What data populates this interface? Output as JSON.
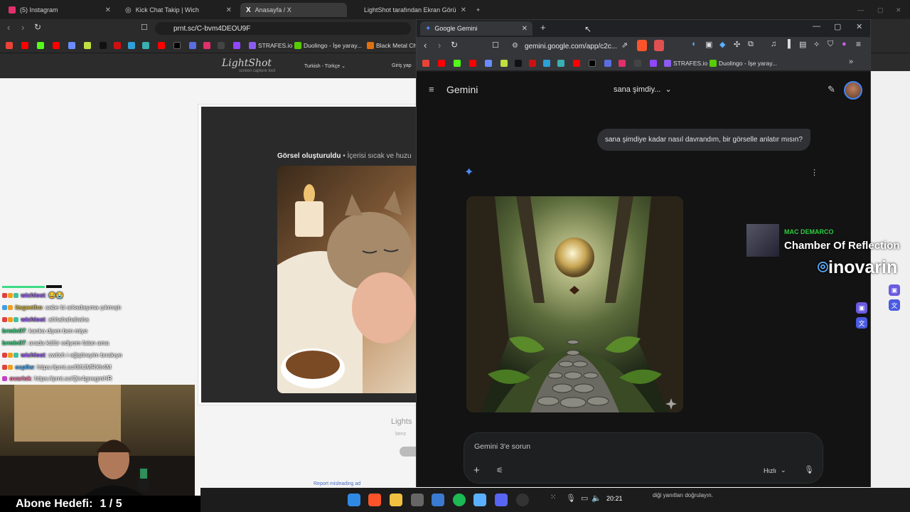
{
  "background_browser": {
    "tabs": [
      {
        "label": "(5) Instagram",
        "icon": "instagram-icon"
      },
      {
        "label": "Kick Chat Takip | Wich",
        "icon": "globe-icon"
      },
      {
        "label": "Anasayfa / X",
        "icon": "x-icon"
      },
      {
        "label": "LightShot tarafından Ekran Görü",
        "icon": "lightshot-icon"
      }
    ],
    "url": "prnt.sc/C-bvm4DEOU9F",
    "bookmarks": [
      "STRAFES.io",
      "Duolingo - İşe yaray...",
      "Black Metal Chr"
    ]
  },
  "lightshot": {
    "logo": "LightShot",
    "logo_sub": "screen capture tool",
    "language": "Turkish - Türkçe",
    "login": "Giriş yap",
    "caption_bold": "Görsel oluşturuldu",
    "caption_rest": " • İçerisi sıcak ve huzu",
    "footer_title": "Lights",
    "footer_sub": "benz",
    "report": "Report misleading ad"
  },
  "chat": [
    {
      "user": "wichlost",
      "msg": ":  😂😭",
      "color": "#9b59ff"
    },
    {
      "user": "itsgeetho",
      "msg": ": aabe bi arkadaşıma çıkmıştı",
      "color": "#e0c040"
    },
    {
      "user": "wichlost",
      "msg": ": ahhahahahaha",
      "color": "#9b59ff"
    },
    {
      "user": "brmln97",
      "msg": ": kanka diyen ben miyo",
      "color": "#3ddc84"
    },
    {
      "user": "brmln97",
      "msg": ": arada küfür ediyom falan ama",
      "color": "#3ddc84"
    },
    {
      "user": "wichlost",
      "msg": ": switch i eğiştireyim bırakıyo",
      "color": "#9b59ff"
    },
    {
      "user": "ecp0w",
      "msg": ": https://prnt.sc/0ifIJMRXh4M",
      "color": "#4ab0ff"
    },
    {
      "user": "ovarlok",
      "msg": ": https://prnt.sc/Qic4gnegmHR",
      "color": "#ff7ab0"
    }
  ],
  "stream": {
    "goal_label": "Abone Hedefi:",
    "goal_value": "1 / 5",
    "music_artist": "MAC DEMARCO",
    "music_title": "Chamber Of Reflection",
    "sponsor": "inovarin"
  },
  "taskbar": {
    "time": "20:21"
  },
  "gemini": {
    "tab_title": "Google Gemini",
    "url": "gemini.google.com/app/c2c...",
    "bookmarks": [
      "STRAFES.io",
      "Duolingo - İşe yaray..."
    ],
    "app_title": "Gemini",
    "model_selector": "sana şimdiy...",
    "user_message": "sana şimdiye kadar nasıl davrandım, bir görselle anlatır mısın?",
    "input_placeholder": "Gemini 3'e sorun",
    "speed_label": "Hızlı",
    "disclaimer": "diği yanıtları doğrulayın."
  }
}
